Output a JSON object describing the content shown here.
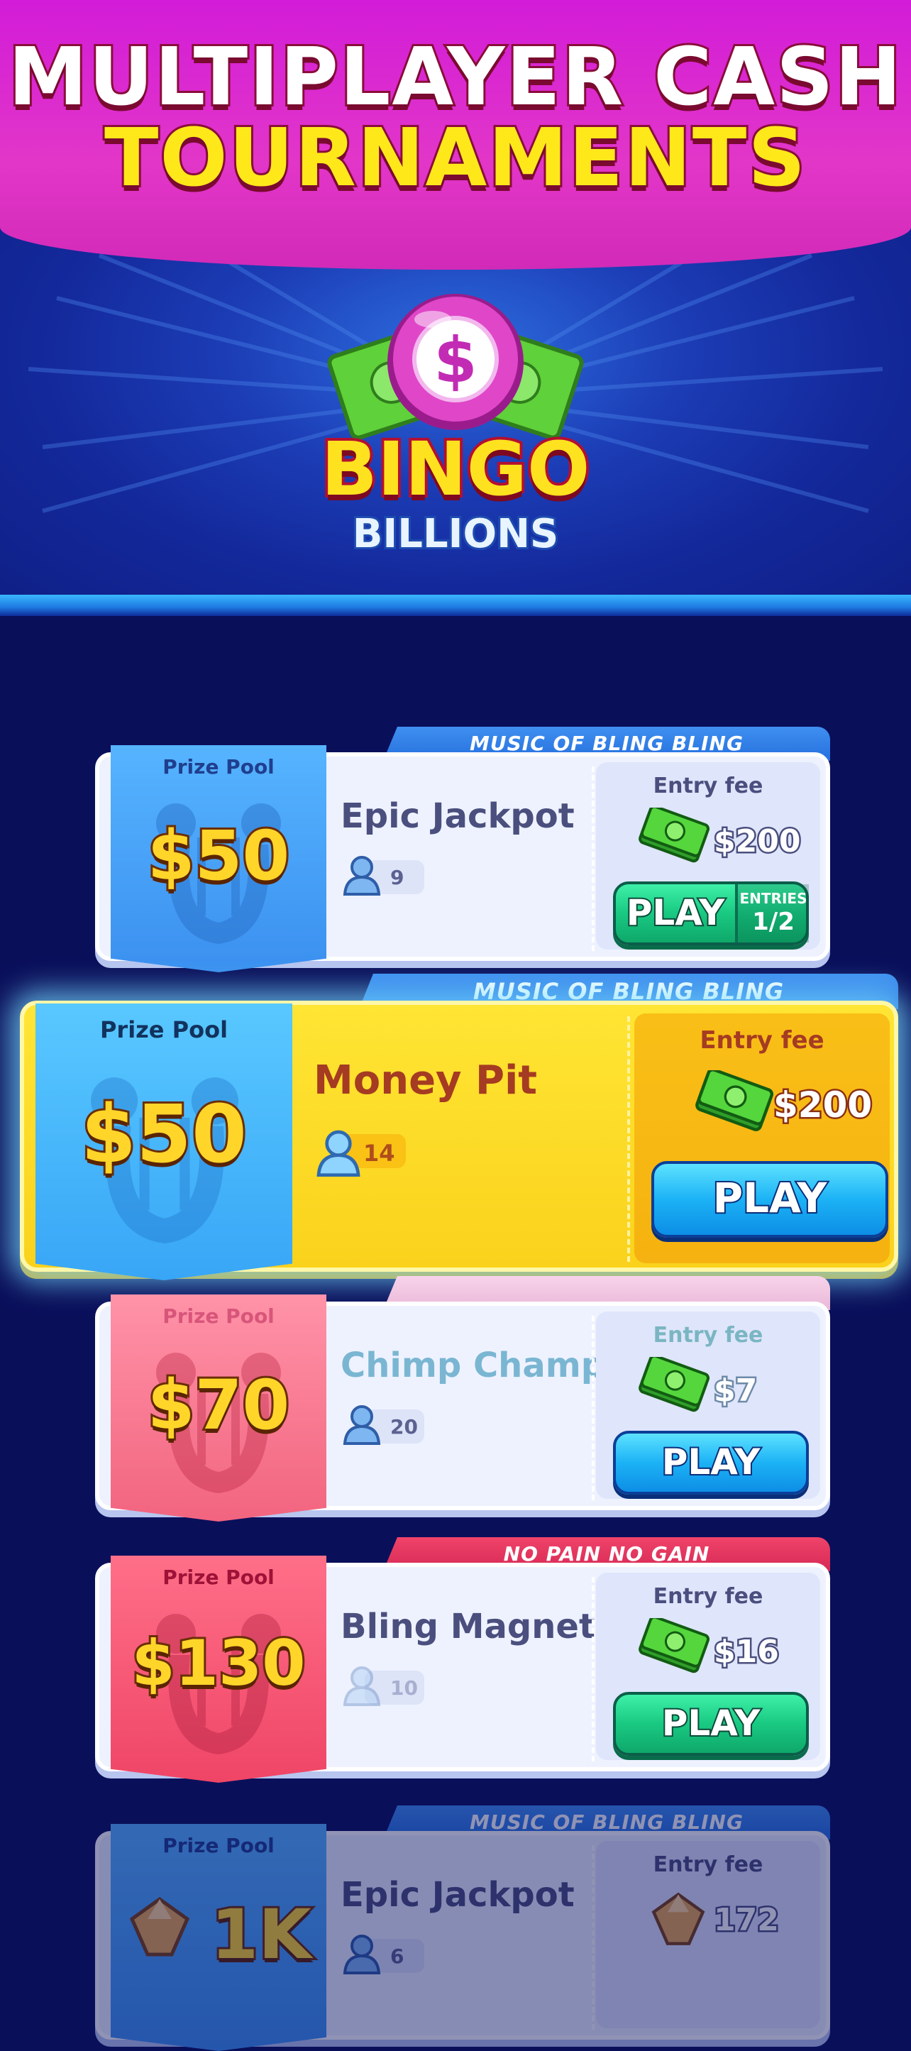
{
  "header": {
    "headline_line1": "MULTIPLAYER CASH",
    "headline_line2": "TOURNAMENTS"
  },
  "logo": {
    "icon": "dollar-ball-icon",
    "word1": "BINGO",
    "word2": "BILLIONS"
  },
  "colors": {
    "banner_magenta": "#d21cd8",
    "hero_blue": "#1c3db6",
    "list_bg": "#0a0f5a",
    "card_highlight_yellow": "#ffe534",
    "play_green": "#19c982",
    "play_blue": "#1cb2f5",
    "prize_blue": "#3b90ef",
    "prize_pink": "#ef4566"
  },
  "tournaments": [
    {
      "ribbon": "MUSIC OF BLING BLING",
      "prize_label": "Prize Pool",
      "prize_amount": "$50",
      "name": "Epic Jackpot",
      "players": "9",
      "fee_label": "Entry fee",
      "fee_amount": "$200",
      "fee_icon": "cash-stack-icon",
      "play_label": "PLAY",
      "entries_label": "ENTRIES",
      "entries_value": "1/2"
    },
    {
      "ribbon": "MUSIC OF BLING BLING",
      "prize_label": "Prize Pool",
      "prize_amount": "$50",
      "name": "Money Pit",
      "players": "14",
      "fee_label": "Entry fee",
      "fee_amount": "$200",
      "fee_icon": "cash-stack-icon",
      "play_label": "PLAY"
    },
    {
      "ribbon": "",
      "prize_label": "Prize Pool",
      "prize_amount": "$70",
      "name": "Chimp Champ",
      "players": "20",
      "fee_label": "Entry fee",
      "fee_amount": "$7",
      "fee_icon": "cash-stack-icon",
      "play_label": "PLAY"
    },
    {
      "ribbon": "NO PAIN NO GAIN",
      "prize_label": "Prize Pool",
      "prize_amount": "$130",
      "name": "Bling Magnet",
      "players": "10",
      "fee_label": "Entry fee",
      "fee_amount": "$16",
      "fee_icon": "cash-stack-icon",
      "play_label": "PLAY"
    },
    {
      "ribbon": "MUSIC OF BLING BLING",
      "prize_label": "Prize Pool",
      "prize_amount": "1K",
      "prize_icon": "gem-icon",
      "name": "Epic Jackpot",
      "players": "6",
      "fee_label": "Entry fee",
      "fee_amount": "172",
      "fee_icon": "gem-icon"
    }
  ]
}
